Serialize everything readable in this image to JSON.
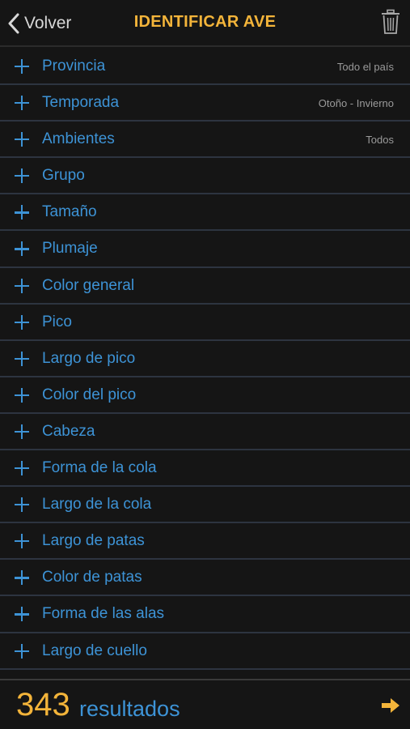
{
  "nav": {
    "back_label": "Volver",
    "title": "IDENTIFICAR AVE",
    "trash_icon": "trash-icon",
    "accent_color": "#f3b43a"
  },
  "filters": [
    {
      "label": "Provincia",
      "value": "Todo el país"
    },
    {
      "label": "Temporada",
      "value": "Otoño - Invierno"
    },
    {
      "label": "Ambientes",
      "value": "Todos"
    },
    {
      "label": "Grupo",
      "value": ""
    },
    {
      "label": "Tamaño",
      "value": ""
    },
    {
      "label": "Plumaje",
      "value": ""
    },
    {
      "label": "Color general",
      "value": ""
    },
    {
      "label": "Pico",
      "value": ""
    },
    {
      "label": "Largo de pico",
      "value": ""
    },
    {
      "label": "Color del pico",
      "value": ""
    },
    {
      "label": "Cabeza",
      "value": ""
    },
    {
      "label": "Forma de la cola",
      "value": ""
    },
    {
      "label": "Largo de la cola",
      "value": ""
    },
    {
      "label": "Largo de patas",
      "value": ""
    },
    {
      "label": "Color de patas",
      "value": ""
    },
    {
      "label": "Forma de las alas",
      "value": ""
    },
    {
      "label": "Largo de cuello",
      "value": ""
    }
  ],
  "footer": {
    "count": "343",
    "results_label": "resultados",
    "next_icon": "arrow-right-icon"
  },
  "colors": {
    "background": "#151515",
    "link_blue": "#3d93d6",
    "separator": "#2d3440"
  }
}
